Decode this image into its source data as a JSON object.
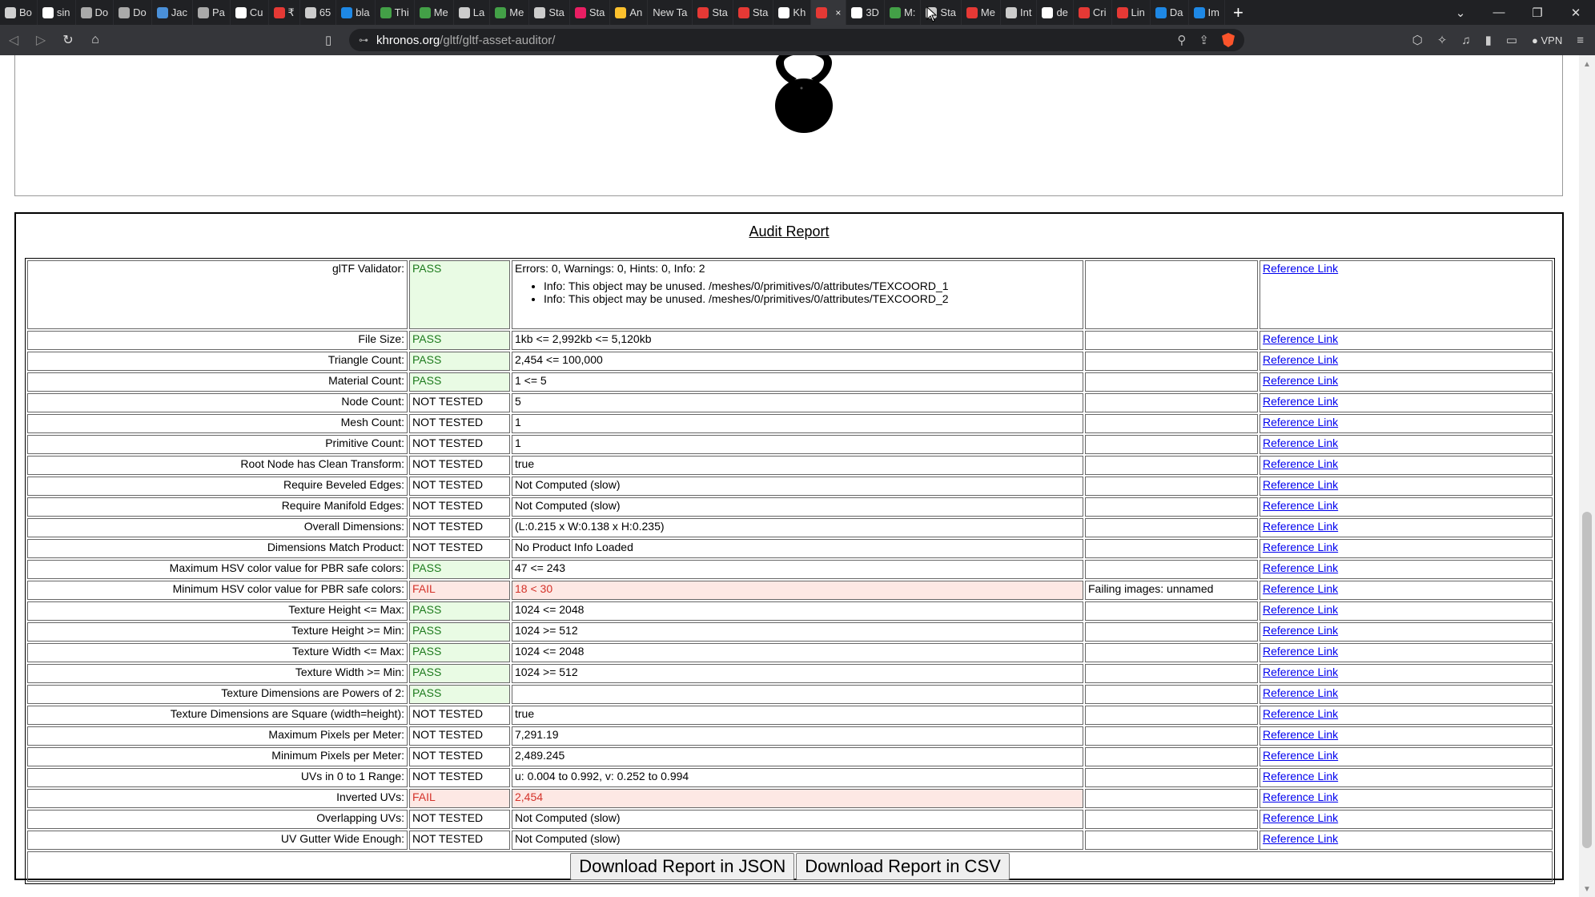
{
  "browser": {
    "tabs": [
      {
        "label": "Bo",
        "color": "#d0d0d0"
      },
      {
        "label": "sin",
        "color": "#ffffff"
      },
      {
        "label": "Do",
        "color": "#aaaaaa"
      },
      {
        "label": "Do",
        "color": "#aaaaaa"
      },
      {
        "label": "Jac",
        "color": "#4a90d9"
      },
      {
        "label": "Pa",
        "color": "#aaaaaa"
      },
      {
        "label": "Cu",
        "color": "#ffffff"
      },
      {
        "label": "₹",
        "color": "#e53935"
      },
      {
        "label": "65",
        "color": "#cccccc"
      },
      {
        "label": "bla",
        "color": "#1e88e5"
      },
      {
        "label": "Thi",
        "color": "#43a047"
      },
      {
        "label": "Me",
        "color": "#43a047"
      },
      {
        "label": "La",
        "color": "#cccccc"
      },
      {
        "label": "Me",
        "color": "#43a047"
      },
      {
        "label": "Sta",
        "color": "#cccccc"
      },
      {
        "label": "Sta",
        "color": "#e91e63"
      },
      {
        "label": "An",
        "color": "#fbc02d"
      },
      {
        "label": "New Ta",
        "color": ""
      },
      {
        "label": "Sta",
        "color": "#e53935"
      },
      {
        "label": "Sta",
        "color": "#e53935"
      },
      {
        "label": "Kh",
        "color": "#ffffff"
      },
      {
        "label": "",
        "color": "#e53935",
        "active": true
      },
      {
        "label": "3D",
        "color": "#ffffff"
      },
      {
        "label": "M:",
        "color": "#43a047"
      },
      {
        "label": "Sta",
        "color": "#cccccc"
      },
      {
        "label": "Me",
        "color": "#e53935"
      },
      {
        "label": "Int",
        "color": "#cccccc"
      },
      {
        "label": "de",
        "color": "#ffffff"
      },
      {
        "label": "Cri",
        "color": "#e53935"
      },
      {
        "label": "Lin",
        "color": "#e53935"
      },
      {
        "label": "Da",
        "color": "#1e88e5"
      },
      {
        "label": "Im",
        "color": "#1e88e5"
      }
    ],
    "new_tab": "+",
    "tab_close": "×",
    "url_host": "khronos.org",
    "url_path": "/gltf/gltf-asset-auditor/",
    "vpn_label": "VPN"
  },
  "report": {
    "title": "Audit Report",
    "link_text": "Reference Link",
    "rows": [
      {
        "label": "glTF Validator:",
        "status": "PASS",
        "desc": "Errors: 0, Warnings: 0, Hints: 0, Info: 2",
        "info": [
          "Info: This object may be unused. /meshes/0/primitives/0/attributes/TEXCOORD_1",
          "Info: This object may be unused. /meshes/0/primitives/0/attributes/TEXCOORD_2"
        ],
        "extra": ""
      },
      {
        "label": "File Size:",
        "status": "PASS",
        "desc": "1kb <= 2,992kb <= 5,120kb",
        "extra": ""
      },
      {
        "label": "Triangle Count:",
        "status": "PASS",
        "desc": "2,454 <= 100,000",
        "extra": ""
      },
      {
        "label": "Material Count:",
        "status": "PASS",
        "desc": "1 <= 5",
        "extra": ""
      },
      {
        "label": "Node Count:",
        "status": "NOT TESTED",
        "desc": "5",
        "extra": ""
      },
      {
        "label": "Mesh Count:",
        "status": "NOT TESTED",
        "desc": "1",
        "extra": ""
      },
      {
        "label": "Primitive Count:",
        "status": "NOT TESTED",
        "desc": "1",
        "extra": ""
      },
      {
        "label": "Root Node has Clean Transform:",
        "status": "NOT TESTED",
        "desc": "true",
        "extra": ""
      },
      {
        "label": "Require Beveled Edges:",
        "status": "NOT TESTED",
        "desc": "Not Computed (slow)",
        "extra": ""
      },
      {
        "label": "Require Manifold Edges:",
        "status": "NOT TESTED",
        "desc": "Not Computed (slow)",
        "extra": ""
      },
      {
        "label": "Overall Dimensions:",
        "status": "NOT TESTED",
        "desc": "(L:0.215 x W:0.138 x H:0.235)",
        "extra": ""
      },
      {
        "label": "Dimensions Match Product:",
        "status": "NOT TESTED",
        "desc": "No Product Info Loaded",
        "extra": ""
      },
      {
        "label": "Maximum HSV color value for PBR safe colors:",
        "status": "PASS",
        "desc": "47 <= 243",
        "extra": ""
      },
      {
        "label": "Minimum HSV color value for PBR safe colors:",
        "status": "FAIL",
        "desc": "18 < 30",
        "extra": "Failing images: unnamed"
      },
      {
        "label": "Texture Height <= Max:",
        "status": "PASS",
        "desc": "1024 <= 2048",
        "extra": ""
      },
      {
        "label": "Texture Height >= Min:",
        "status": "PASS",
        "desc": "1024 >= 512",
        "extra": ""
      },
      {
        "label": "Texture Width <= Max:",
        "status": "PASS",
        "desc": "1024 <= 2048",
        "extra": ""
      },
      {
        "label": "Texture Width >= Min:",
        "status": "PASS",
        "desc": "1024 >= 512",
        "extra": ""
      },
      {
        "label": "Texture Dimensions are Powers of 2:",
        "status": "PASS",
        "desc": "",
        "extra": ""
      },
      {
        "label": "Texture Dimensions are Square (width=height):",
        "status": "NOT TESTED",
        "desc": "true",
        "extra": ""
      },
      {
        "label": "Maximum Pixels per Meter:",
        "status": "NOT TESTED",
        "desc": "7,291.19",
        "extra": ""
      },
      {
        "label": "Minimum Pixels per Meter:",
        "status": "NOT TESTED",
        "desc": "2,489.245",
        "extra": ""
      },
      {
        "label": "UVs in 0 to 1 Range:",
        "status": "NOT TESTED",
        "desc": "u: 0.004 to 0.992, v: 0.252 to 0.994",
        "extra": ""
      },
      {
        "label": "Inverted UVs:",
        "status": "FAIL",
        "desc": "2,454",
        "extra": ""
      },
      {
        "label": "Overlapping UVs:",
        "status": "NOT TESTED",
        "desc": "Not Computed (slow)",
        "extra": ""
      },
      {
        "label": "UV Gutter Wide Enough:",
        "status": "NOT TESTED",
        "desc": "Not Computed (slow)",
        "extra": ""
      }
    ],
    "download_json": "Download Report in JSON",
    "download_csv": "Download Report in CSV"
  }
}
